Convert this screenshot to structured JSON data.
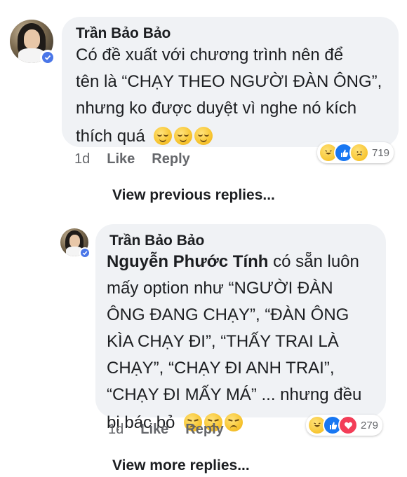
{
  "comment1": {
    "author": "Trần Bảo Bảo",
    "lines": [
      "Có đề xuất với chương trình nên để",
      "tên là “CHẠY THEO NGƯỜI ĐÀN ÔNG”,",
      "nhưng ko được duyệt vì nghe nó kích",
      "thích quá"
    ],
    "emojis": [
      "relieved-face-emoji",
      "relieved-face-emoji",
      "relieved-face-emoji"
    ],
    "time": "1d",
    "like_label": "Like",
    "reply_label": "Reply",
    "reactions": [
      "haha",
      "like",
      "sad"
    ],
    "reaction_count": "719"
  },
  "view_previous": "View previous replies...",
  "reply1": {
    "author": "Trần Bảo Bảo",
    "mention": "Nguyễn Phước Tính",
    "first_line_rest": " có sẵn luôn",
    "lines": [
      "mấy option như “NGƯỜI ĐÀN",
      "ÔNG ĐANG CHẠY”, “ĐÀN ÔNG",
      "KÌA CHẠY ĐI”, “THẤY TRAI LÀ",
      "CHẠY”, “CHẠY ĐI ANH TRAI”,",
      "“CHẠY ĐI MẤY MÁ” ... nhưng đều",
      "bị bác bỏ"
    ],
    "emojis": [
      "disappointed-face-emoji",
      "disappointed-face-emoji",
      "disappointed-face-emoji"
    ],
    "time": "1d",
    "like_label": "Like",
    "reply_label": "Reply",
    "reactions": [
      "haha",
      "like",
      "love"
    ],
    "reaction_count": "279"
  },
  "view_more": "View more replies...",
  "colors": {
    "bubble": "#f0f2f5",
    "meta": "#65676b",
    "verified": "#4a76e8",
    "like": "#1877f2",
    "love": "#f33e58"
  }
}
